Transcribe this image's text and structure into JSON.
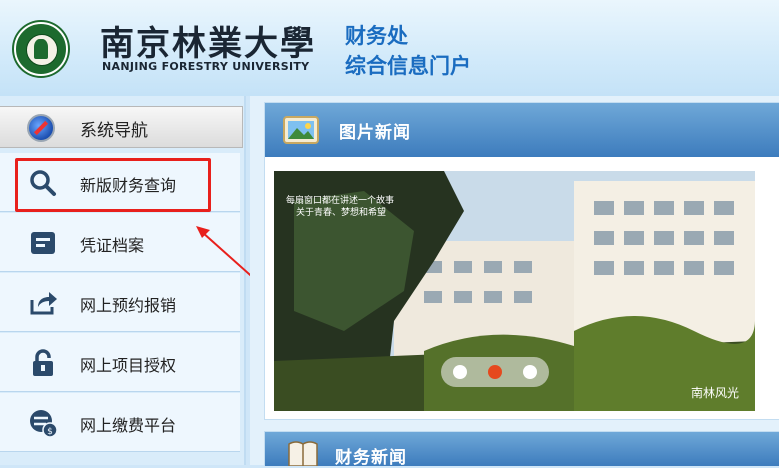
{
  "header": {
    "university_cn": "南京林業大學",
    "university_en": "NANJING FORESTRY UNIVERSITY",
    "portal_line1": "财务处",
    "portal_line2": "综合信息门户"
  },
  "sidebar": {
    "title": "系统导航",
    "items": [
      {
        "label": "新版财务查询",
        "icon": "search-icon"
      },
      {
        "label": "凭证档案",
        "icon": "archive-icon"
      },
      {
        "label": "网上预约报销",
        "icon": "share-arrow-icon"
      },
      {
        "label": "网上项目授权",
        "icon": "lock-icon"
      },
      {
        "label": "网上缴费平台",
        "icon": "payment-globe-icon"
      }
    ]
  },
  "main": {
    "photo_news": {
      "title": "图片新闻",
      "caption_line1": "每扇窗口都在讲述一个故事",
      "caption_line2": "关于青春、梦想和希望",
      "corner_text": "南林风光",
      "slides_total": 3,
      "active_slide": 2
    },
    "finance_news": {
      "title": "财务新闻"
    }
  },
  "colors": {
    "accent_blue": "#3d7cbd",
    "highlight_red": "#e8201c",
    "carousel_active": "#e5491e"
  }
}
